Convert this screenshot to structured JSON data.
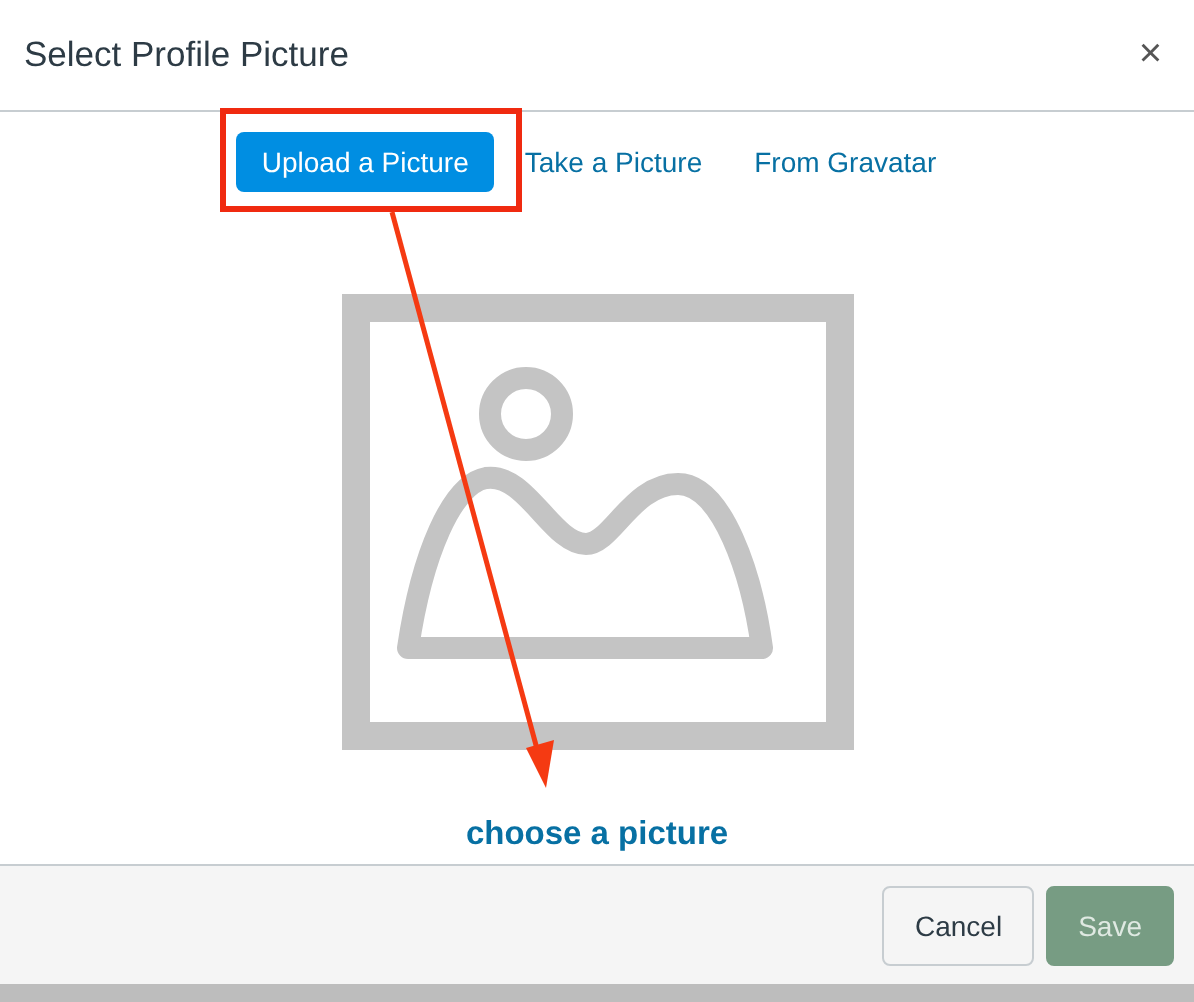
{
  "dialog": {
    "title": "Select Profile Picture",
    "close": "×"
  },
  "tabs": [
    {
      "label": "Upload a Picture",
      "selected": true
    },
    {
      "label": "Take a Picture",
      "selected": false
    },
    {
      "label": "From Gravatar",
      "selected": false
    }
  ],
  "upload": {
    "link": "choose a picture"
  },
  "buttons": [
    {
      "label": "Cancel",
      "kind": "secondary",
      "disabled": false
    },
    {
      "label": "Save",
      "kind": "primary",
      "disabled": true
    }
  ]
}
